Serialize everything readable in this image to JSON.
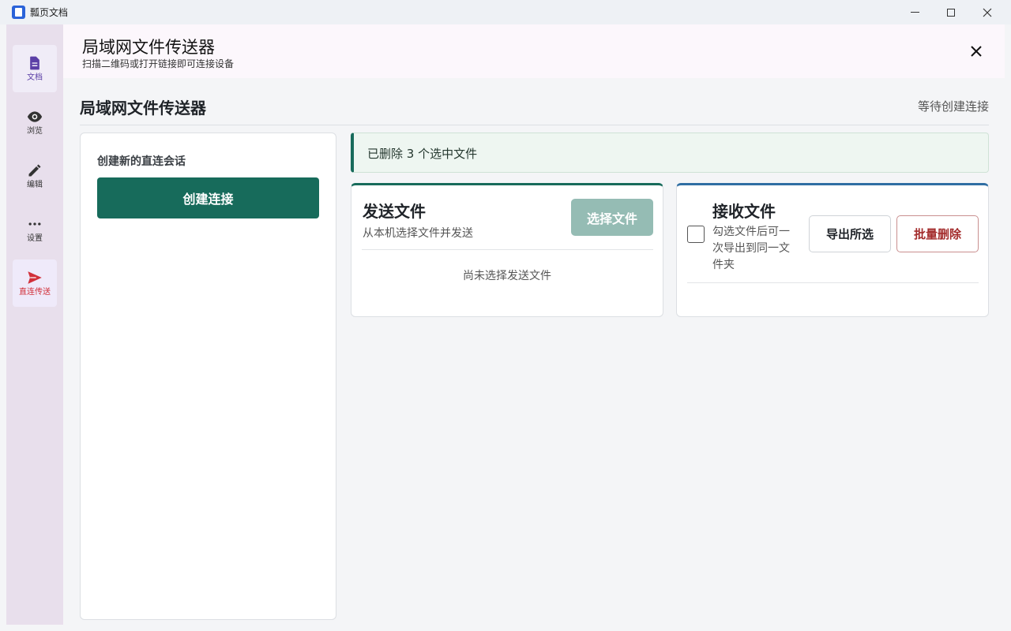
{
  "window": {
    "app_title": "瓢页文档",
    "minimize_icon": "minimize-icon",
    "maximize_icon": "maximize-icon",
    "close_icon": "close-icon"
  },
  "rail": {
    "items": [
      {
        "label": "文档",
        "icon": "document-icon",
        "active": true
      },
      {
        "label": "浏览",
        "icon": "eye-icon",
        "active": false
      },
      {
        "label": "编辑",
        "icon": "pencil-icon",
        "active": false
      },
      {
        "label": "设置",
        "icon": "more-dots-icon",
        "active": false
      },
      {
        "label": "直连传送",
        "icon": "send-icon",
        "active": true
      }
    ]
  },
  "header": {
    "title": "局域网文件传送器",
    "subtitle": "扫描二维码或打开链接即可连接设备"
  },
  "page": {
    "title": "局域网文件传送器",
    "status": "等待创建连接"
  },
  "session": {
    "label": "创建新的直连会话",
    "create_button": "创建连接"
  },
  "notice": {
    "text": "已删除 3 个选中文件"
  },
  "send": {
    "title": "发送文件",
    "subtitle": "从本机选择文件并发送",
    "select_button": "选择文件",
    "empty_text": "尚未选择发送文件"
  },
  "receive": {
    "title": "接收文件",
    "hint": "勾选文件后可一次导出到同一文件夹",
    "export_button": "导出所选",
    "delete_button": "批量删除",
    "select_all_checked": false
  },
  "colors": {
    "primary": "#176b5b",
    "primary_disabled": "#95bcb4",
    "receive_accent": "#2f6ea3",
    "danger": "#a32c2c",
    "active_rail_send": "#d1303a",
    "active_rail_doc": "#5b3fa6"
  }
}
